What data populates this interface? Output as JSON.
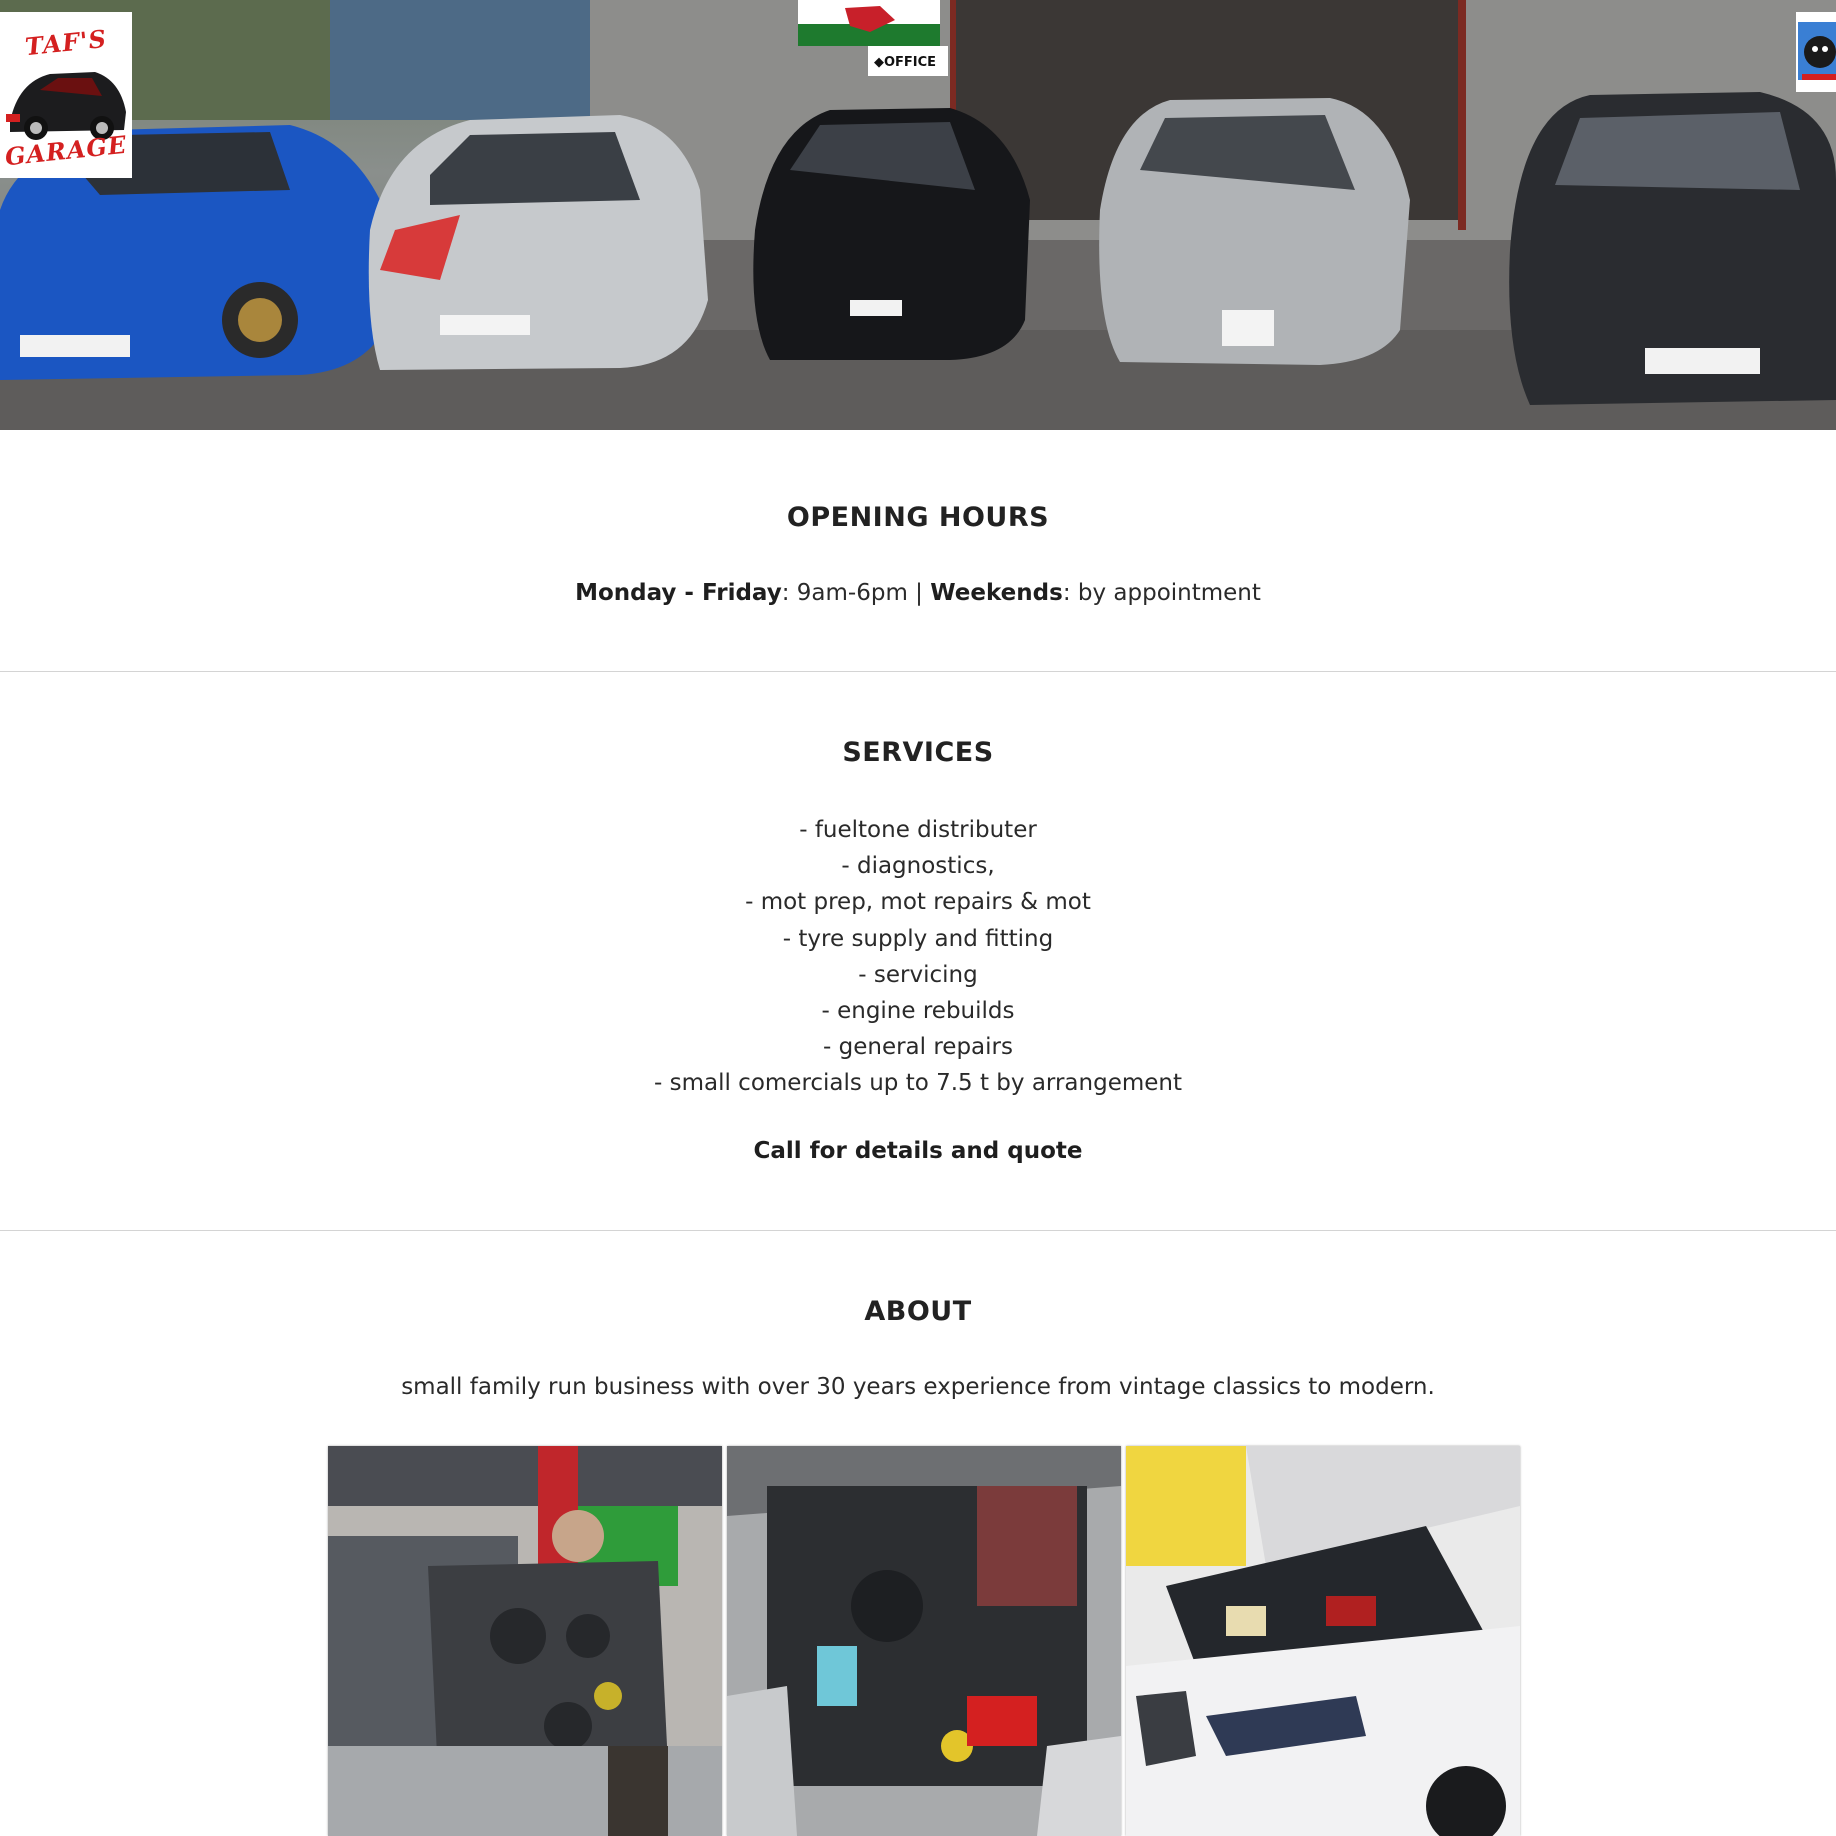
{
  "brand": {
    "logo_top": "TAF'S",
    "logo_bottom": "GARAGE"
  },
  "hero": {
    "image": "garage-forecourt-with-subaru-cars",
    "sign_office": "◆OFFICE"
  },
  "opening_hours": {
    "title": "OPENING HOURS",
    "weekday_label": "Monday - Friday",
    "weekday_hours": ":  9am-6pm | ",
    "weekend_label": "Weekends",
    "weekend_hours": ": by appointment"
  },
  "services": {
    "title": "SERVICES",
    "items": [
      "- fueltone distributer",
      "- diagnostics,",
      "- mot prep, mot repairs & mot",
      "- tyre supply and fitting",
      "- servicing",
      "- engine rebuilds",
      "- general repairs",
      "- small comercials up to 7.5 t by arrangement"
    ],
    "cta": "Call for details and quote"
  },
  "about": {
    "title": "ABOUT",
    "text": "small family run business with over 30 years experience from vintage classics to modern."
  },
  "gallery": {
    "photos": [
      "engine-rebuild-photo",
      "subaru-engine-bay-photo",
      "white-car-engine-bay-photo"
    ]
  },
  "colors": {
    "logo_red": "#d42020",
    "divider": "#d4d4d4",
    "text": "#222222"
  }
}
